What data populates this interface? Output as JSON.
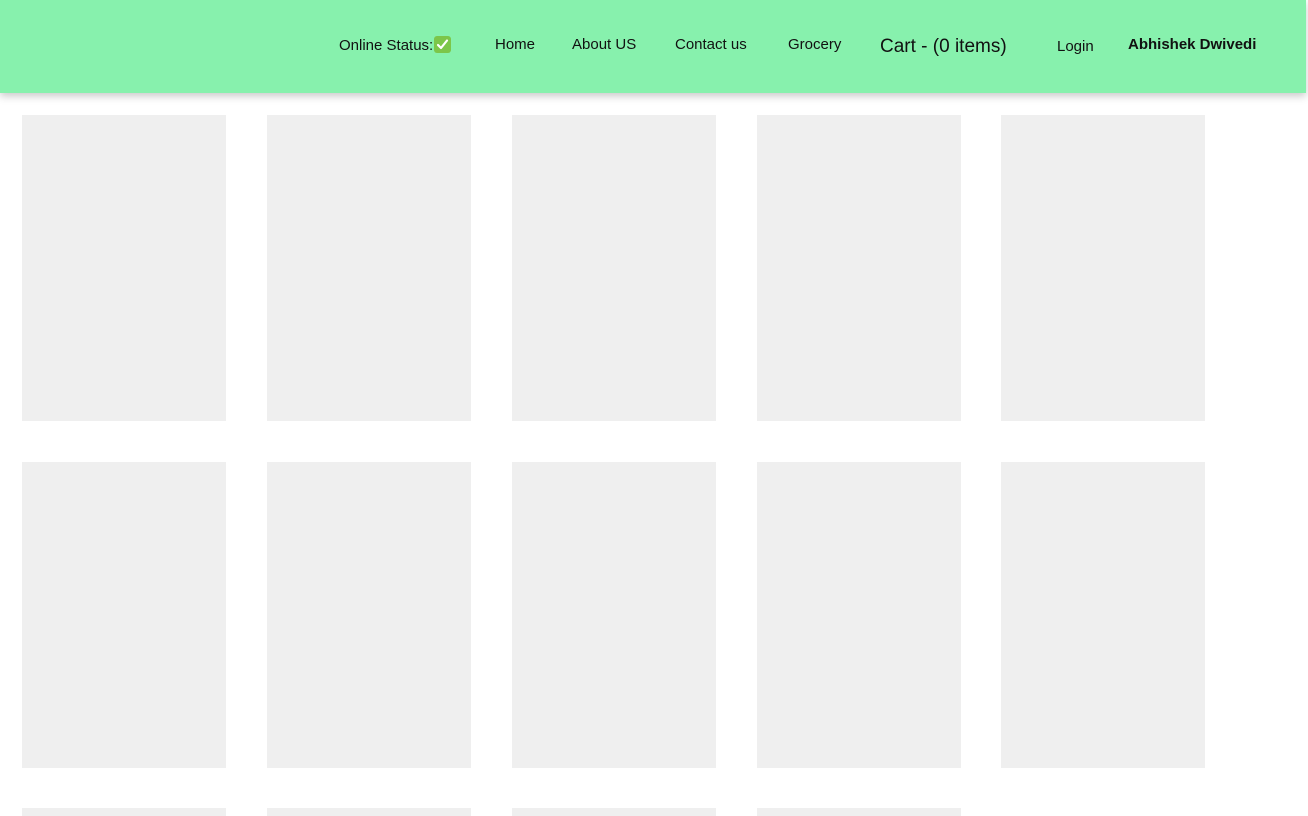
{
  "header": {
    "background_color": "#87f1ad",
    "online_status_label": "Online Status:",
    "online_status_icon": "white-check-mark-icon",
    "nav": {
      "home": "Home",
      "about": "About US",
      "contact": "Contact us",
      "grocery": "Grocery",
      "cart": "Cart - (0 items)",
      "login": "Login",
      "user_name": "Abhishek Dwivedi"
    }
  },
  "shimmer": {
    "placeholder_color": "#efefef",
    "visible_cards": 14
  }
}
